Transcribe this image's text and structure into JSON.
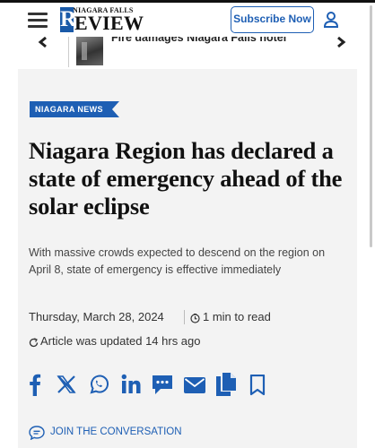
{
  "header": {
    "logo_top": "NIAGARA FALLS",
    "logo_initial": "R",
    "logo_main": "EVIEW",
    "subscribe_label": "Subscribe Now",
    "menu_icon": "hamburger-icon",
    "account_icon": "user-icon"
  },
  "strip": {
    "title": "Fire damages Niagara Falls hotel",
    "prev_icon": "chevron-left-icon",
    "next_icon": "chevron-right-icon"
  },
  "article": {
    "category": "NIAGARA NEWS",
    "headline": "Niagara Region has declared a state of emergency ahead of the solar eclipse",
    "dek": "With massive crowds expected to descend on the region on April 8, state of emergency is effective immediately",
    "date": "Thursday, March 28, 2024",
    "read_time": "1 min to read",
    "updated": "Article was updated 14 hrs ago"
  },
  "share": {
    "icons": [
      "facebook-icon",
      "x-icon",
      "whatsapp-icon",
      "linkedin-icon",
      "comment-icon",
      "email-icon",
      "copy-icon",
      "bookmark-icon"
    ]
  },
  "conversation": {
    "label": "JOIN THE CONVERSATION"
  },
  "colors": {
    "brand_blue": "#1e5fb4",
    "text": "#1a1a1a",
    "article_bg": "#f3f3f3"
  }
}
